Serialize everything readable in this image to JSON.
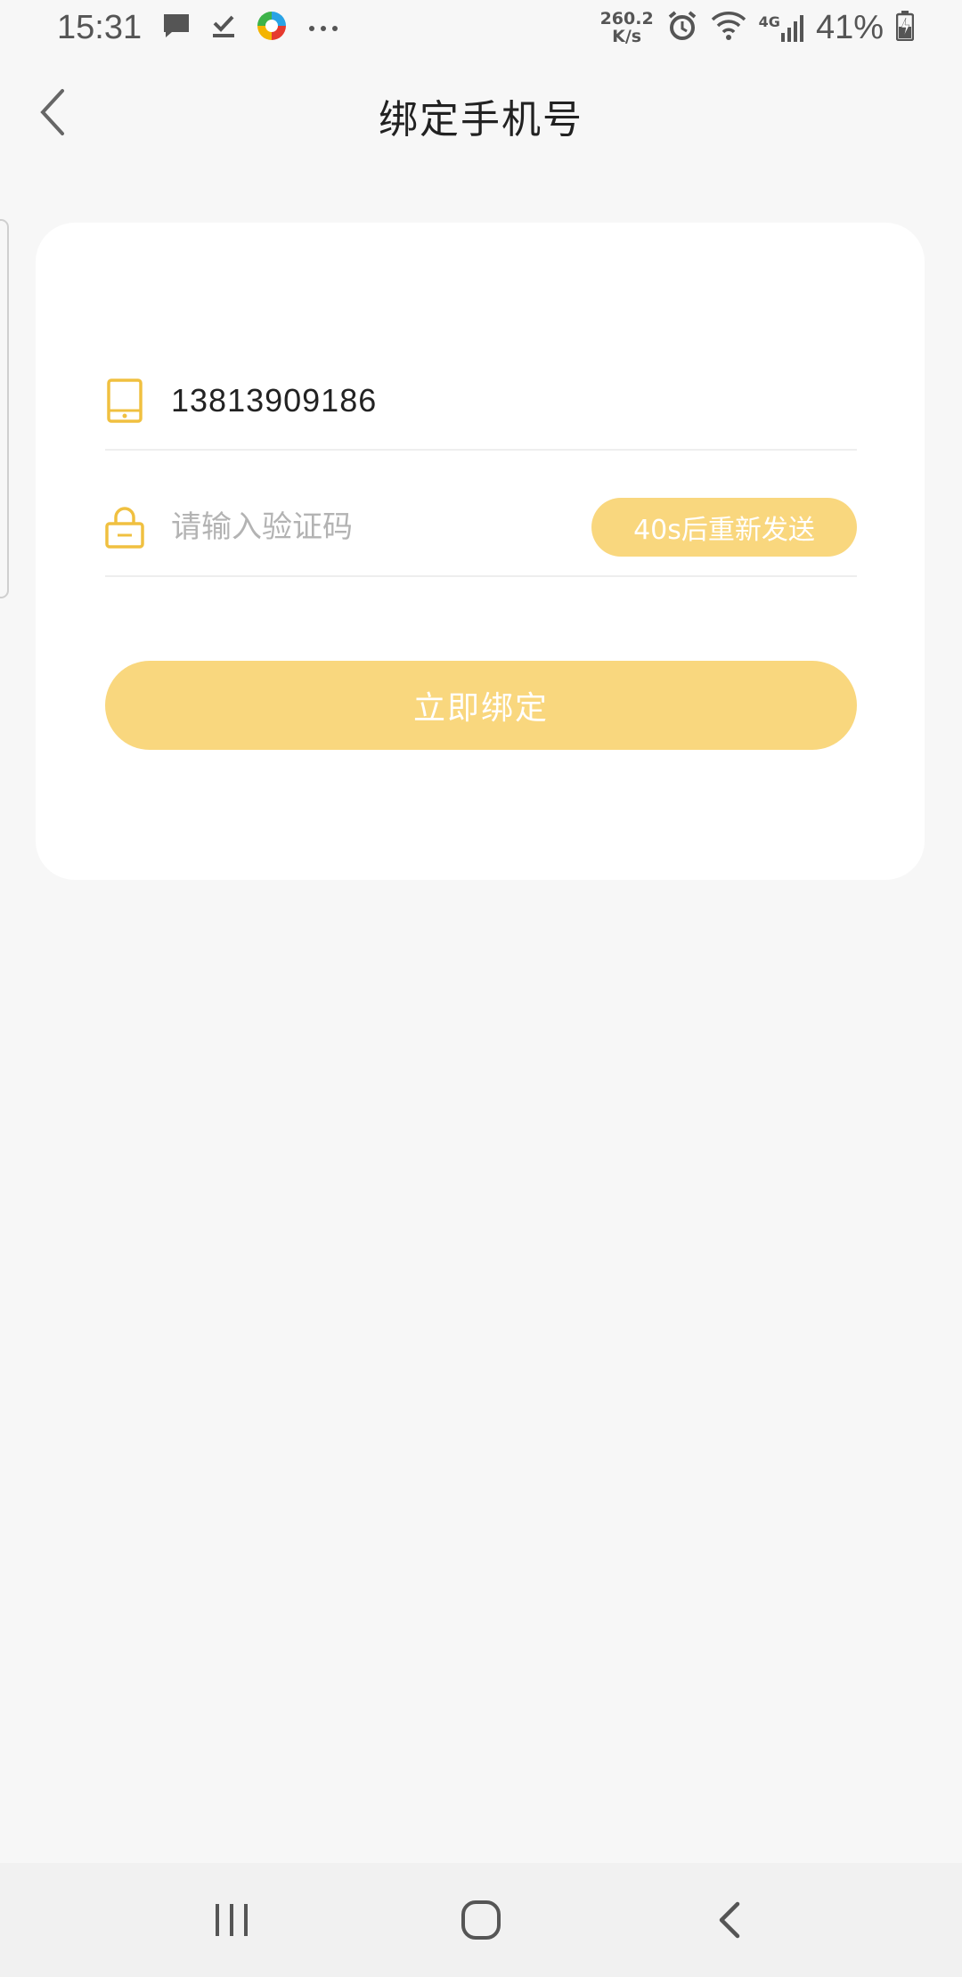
{
  "status_bar": {
    "time": "15:31",
    "net_speed_value": "260.2",
    "net_speed_unit": "K/s",
    "network_type": "4G",
    "battery": "41%",
    "icons": [
      "message-icon",
      "download-done-icon",
      "colorful-app-icon",
      "more-dots-icon",
      "alarm-icon",
      "wifi-icon",
      "signal-icon",
      "battery-charging-icon"
    ]
  },
  "header": {
    "title": "绑定手机号",
    "back_icon": "chevron-left-icon"
  },
  "form": {
    "phone": {
      "icon": "phone-icon",
      "value": "13813909186"
    },
    "code": {
      "icon": "lock-icon",
      "placeholder": "请输入验证码",
      "resend_label": "40s后重新发送"
    },
    "submit_label": "立即绑定"
  },
  "colors": {
    "accent": "#f9d77e",
    "icon": "#f0c040",
    "background": "#f7f7f7"
  },
  "nav_bar": {
    "icons": [
      "recent-apps-icon",
      "home-icon",
      "back-icon"
    ]
  }
}
